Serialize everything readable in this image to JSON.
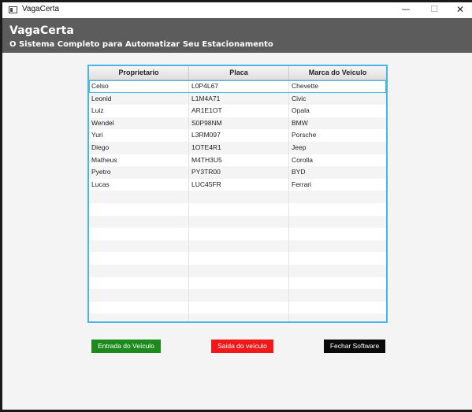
{
  "window": {
    "title": "VagaCerta",
    "controls": {
      "minimize": "—",
      "maximize": "☐",
      "close": "✕"
    }
  },
  "header": {
    "title": "VagaCerta",
    "subtitle": "O Sistema Completo para Automatizar Seu Estacionamento"
  },
  "table": {
    "columns": [
      "Proprietario",
      "Placa",
      "Marca do Veículo"
    ],
    "rows": [
      [
        "Celso",
        "L0P4L67",
        "Chevette"
      ],
      [
        "Leonid",
        "L1M4A71",
        "Civic"
      ],
      [
        "Luiz",
        "AR1E1OT",
        "Opala"
      ],
      [
        "Wendel",
        "S0P98NM",
        "BMW"
      ],
      [
        "Yuri",
        "L3RM097",
        "Porsche"
      ],
      [
        "Diego",
        "1OTE4R1",
        "Jeep"
      ],
      [
        "Matheus",
        "M4TH3U5",
        "Corolla"
      ],
      [
        "Pyetro",
        "PY3TR00",
        "BYD"
      ],
      [
        "Lucas",
        "LUC45FR",
        "Ferrari"
      ]
    ],
    "selected_row": 0
  },
  "buttons": {
    "entrada": "Entrada do Veículo",
    "saida": "Saida do veículo",
    "fechar": "Fechar Software"
  },
  "colors": {
    "header_bg": "#5c5c5c",
    "table_border": "#49b4e6",
    "entrada_bg": "#1c8a1c",
    "saida_bg": "#f01818",
    "fechar_bg": "#0a0a0a"
  }
}
